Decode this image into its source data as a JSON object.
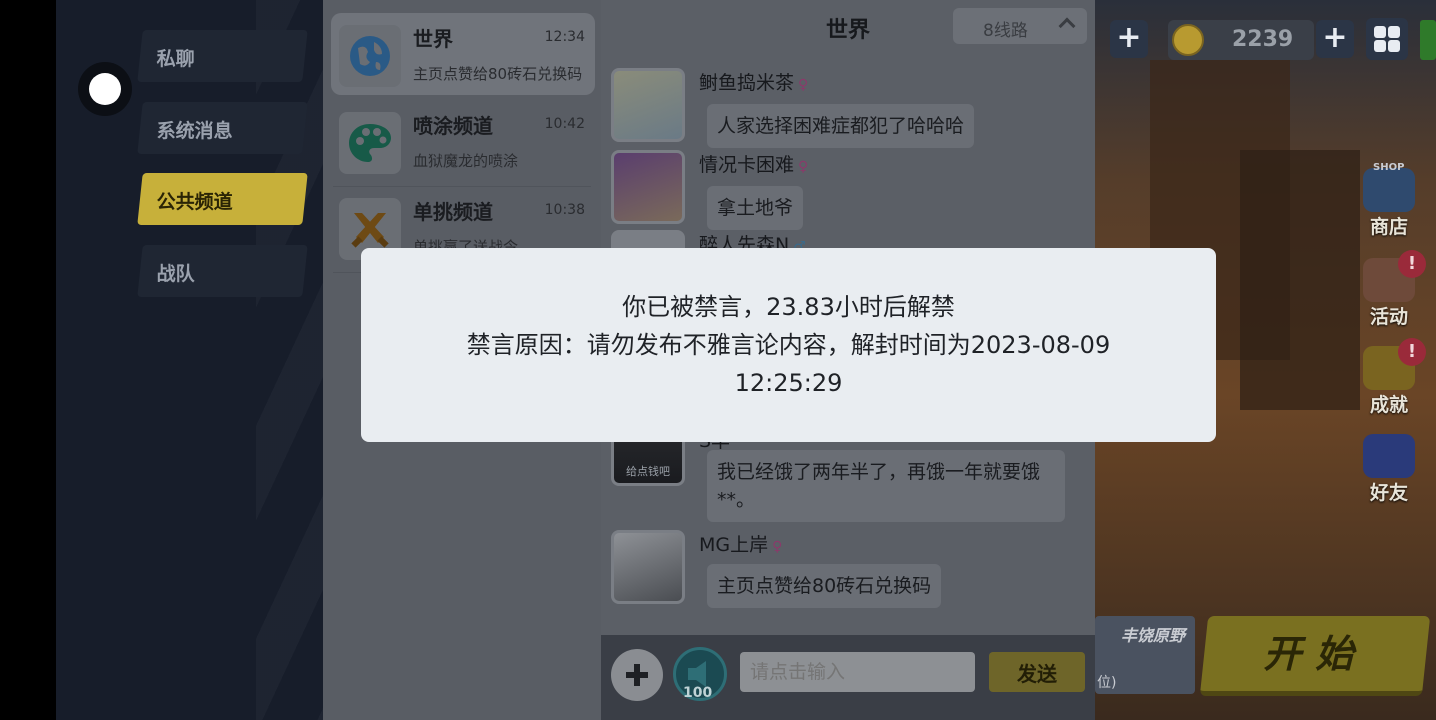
{
  "nav": {
    "items": [
      {
        "label": "私聊",
        "active": false
      },
      {
        "label": "系统消息",
        "active": false
      },
      {
        "label": "公共频道",
        "active": true
      },
      {
        "label": "战队",
        "active": false
      }
    ]
  },
  "channels": [
    {
      "name": "世界",
      "time": "12:34",
      "preview": "主页点赞给80砖石兑换码",
      "icon": "globe-icon",
      "color": "#1f6fb5"
    },
    {
      "name": "喷涂频道",
      "time": "10:42",
      "preview": "血狱魔龙的喷涂",
      "icon": "palette-icon",
      "color": "#1f9e7a"
    },
    {
      "name": "单挑频道",
      "time": "10:38",
      "preview": "单挑赢了送战令",
      "icon": "crossed-swords-icon",
      "color": "#d98a1e"
    }
  ],
  "chat": {
    "title": "世界",
    "route": "8线路",
    "messages": [
      {
        "name": "鲥鱼捣米茶",
        "gender": "♀",
        "text": "人家选择困难症都犯了哈哈哈"
      },
      {
        "name": "情况卡困难",
        "gender": "♀",
        "text": "拿土地爷"
      },
      {
        "name": "醉人先森N",
        "gender": "♂",
        "text": ""
      },
      {
        "name": "S丰",
        "gender": "",
        "text": "我已经饿了两年半了，再饿一年就要饿**。",
        "avatar_caption": "给点钱吧"
      },
      {
        "name": "MG上岸",
        "gender": "♀",
        "text": "主页点赞给80砖石兑换码"
      }
    ]
  },
  "input_bar": {
    "placeholder": "请点击输入",
    "horn_count": "100",
    "send_label": "发送"
  },
  "game": {
    "coins": "2239",
    "side_buttons": [
      {
        "label": "商店",
        "badge": ""
      },
      {
        "label": "活动",
        "badge": "!"
      },
      {
        "label": "成就",
        "badge": "!"
      },
      {
        "label": "好友",
        "badge": ""
      }
    ],
    "shop_sign": "SHOP",
    "mode_name": "丰饶原野",
    "mode_sub": "位)",
    "start_label": "开始"
  },
  "modal": {
    "line1": "你已被禁言，23.83小时后解禁",
    "line2": "禁言原因：请勿发布不雅言论内容，解封时间为2023-08-09",
    "line3": "12:25:29"
  }
}
